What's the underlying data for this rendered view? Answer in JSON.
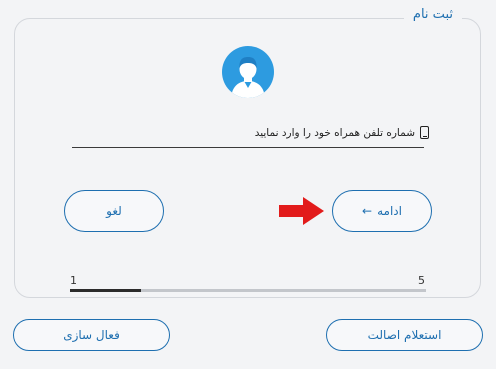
{
  "card": {
    "legend": "ثبت نام"
  },
  "phone": {
    "label": "شماره تلفن همراه خود را وارد نمایید",
    "value": ""
  },
  "buttons": {
    "continue_label": "ادامه",
    "continue_arrow": "←",
    "cancel_label": "لغو",
    "authenticity_label": "استعلام اصالت",
    "activate_label": "فعال سازی"
  },
  "progress": {
    "start": "1",
    "end": "5",
    "fraction": 0.2
  },
  "icons": {
    "avatar": "user-avatar-icon",
    "phone": "mobile-phone-icon",
    "pointer": "red-arrow-right-icon"
  },
  "colors": {
    "accent": "#1e6fb0",
    "avatar_bg": "#2d9be0",
    "pointer": "#e21b1b"
  }
}
